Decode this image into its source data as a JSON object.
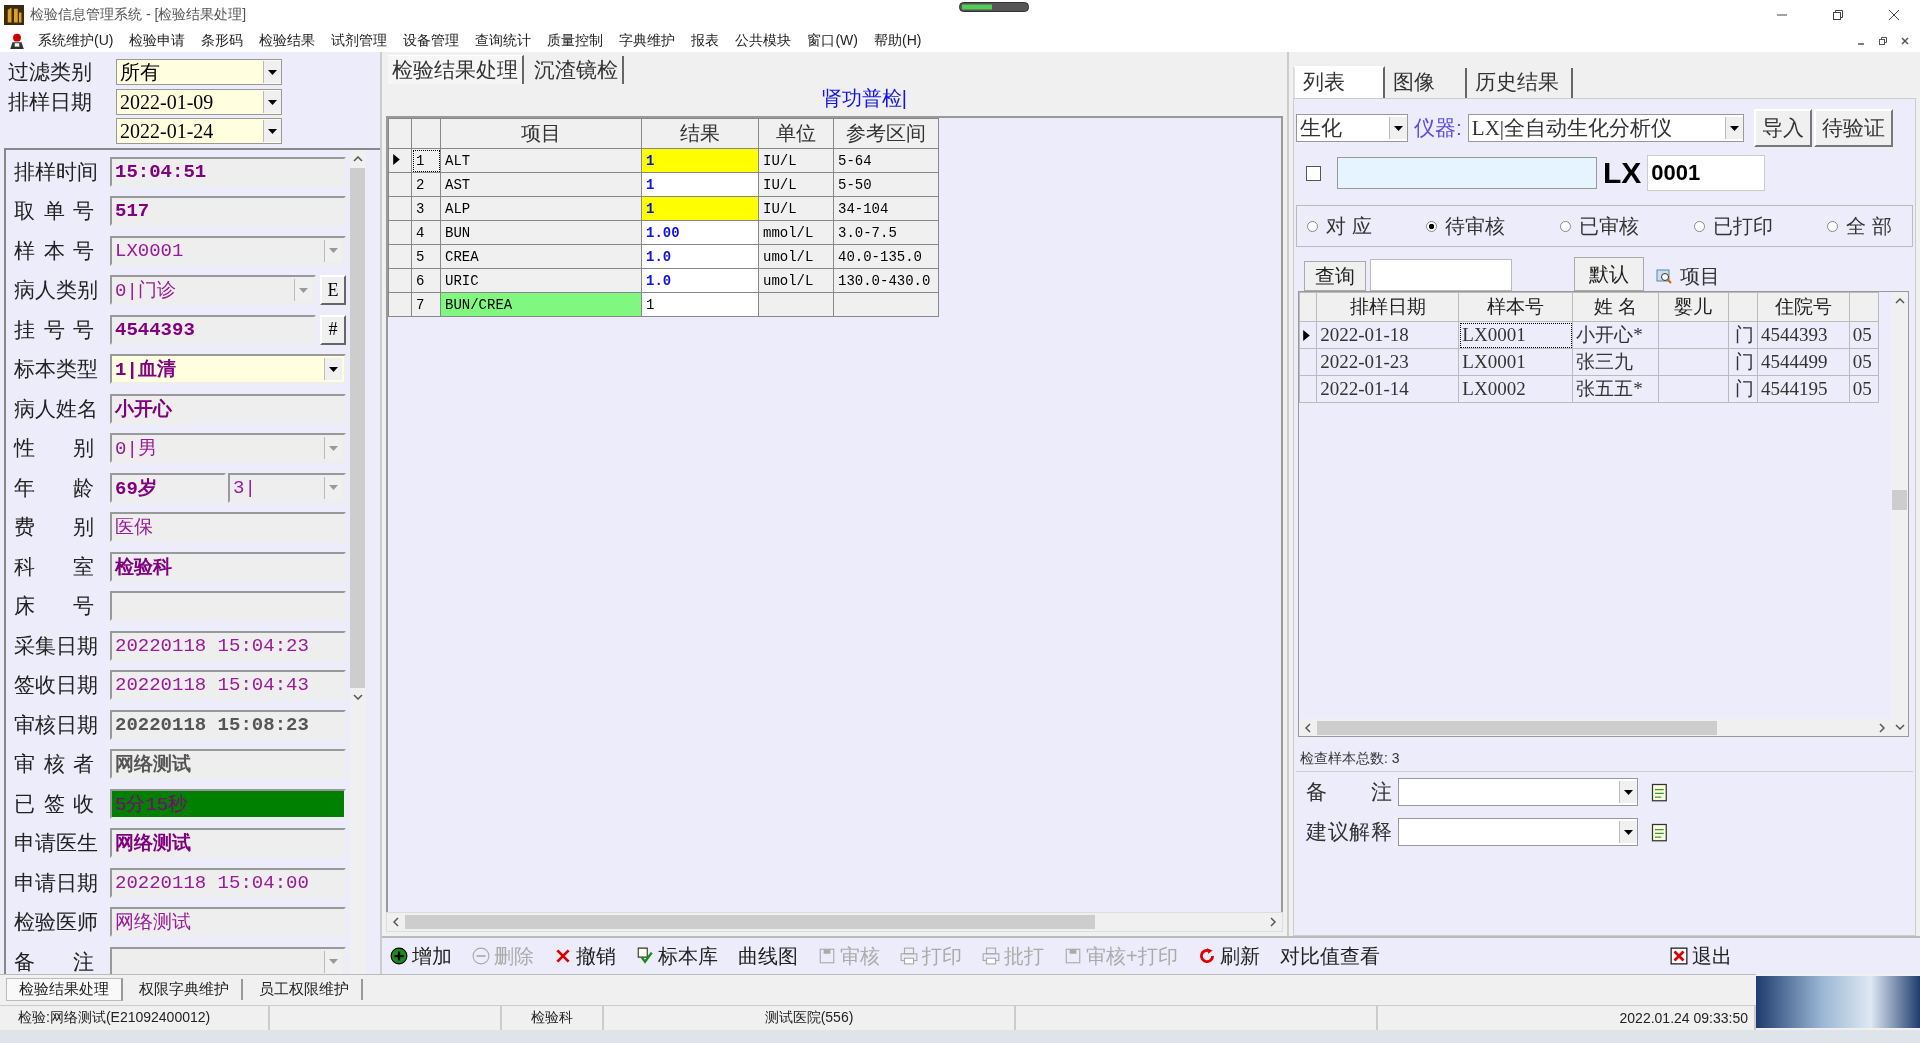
{
  "window": {
    "title": "检验信息管理系统 - [检验结果处理]"
  },
  "menu": [
    "系统维护(U)",
    "检验申请",
    "条形码",
    "检验结果",
    "试剂管理",
    "设备管理",
    "查询统计",
    "质量控制",
    "字典维护",
    "报表",
    "公共模块",
    "窗口(W)",
    "帮助(H)"
  ],
  "filter": {
    "type_label": "过滤类别",
    "type_value": "所有",
    "date_label": "排样日期",
    "date_from": "2022-01-09",
    "date_to": "2022-01-24"
  },
  "form": [
    {
      "label": "排样时间",
      "value": "15:04:51",
      "kind": "text"
    },
    {
      "label": "取 单 号",
      "value": "517",
      "kind": "text"
    },
    {
      "label": "样 本 号",
      "value": "LX0001",
      "kind": "combo"
    },
    {
      "label": "病人类别",
      "value": "0|门诊",
      "kind": "combo-button",
      "button": "E"
    },
    {
      "label": "挂 号 号",
      "value": "4544393",
      "kind": "text-button",
      "button": "#"
    },
    {
      "label": "标本类型",
      "value": "1|血清",
      "kind": "required-combo"
    },
    {
      "label": "病人姓名",
      "value": "小开心",
      "kind": "text"
    },
    {
      "label": "性 别",
      "value": "0|男",
      "kind": "combo"
    },
    {
      "label": "年 龄",
      "value": "69岁",
      "kind": "age",
      "unit": "3|"
    },
    {
      "label": "费 别",
      "value": "医保",
      "kind": "text"
    },
    {
      "label": "科 室",
      "value": "检验科",
      "kind": "text"
    },
    {
      "label": "床 号",
      "kind": "text"
    },
    {
      "label": "采集日期",
      "value": "20220118 15:04:23",
      "kind": "text"
    },
    {
      "label": "签收日期",
      "value": "20220118 15:04:43",
      "kind": "text"
    },
    {
      "label": "审核日期",
      "value": "20220118 15:08:23",
      "kind": "text"
    },
    {
      "label": "审 核 者",
      "value": "网络测试",
      "kind": "text"
    },
    {
      "label": "已 签 收",
      "value": "5分15秒",
      "kind": "status"
    },
    {
      "label": "申请医生",
      "value": "网络测试",
      "kind": "text"
    },
    {
      "label": "申请日期",
      "value": "20220118 15:04:00",
      "kind": "text"
    },
    {
      "label": "检验医师",
      "value": "网络测试",
      "kind": "text"
    },
    {
      "label": "备 注",
      "kind": "combo"
    }
  ],
  "main_tabs": [
    {
      "label": "检验结果处理",
      "selected": true
    },
    {
      "label": "沉渣镜检",
      "selected": false
    }
  ],
  "panel_title": "肾功普检|",
  "results": {
    "columns": [
      "项目",
      "结果",
      "单位",
      "参考区间"
    ],
    "rows": [
      {
        "no": "1",
        "item": "ALT",
        "result": "1",
        "unit": "IU/L",
        "range": "5-64",
        "selected": true,
        "abnormal": true,
        "kind": "measured"
      },
      {
        "no": "2",
        "item": "AST",
        "result": "1",
        "unit": "IU/L",
        "range": "5-50",
        "selected": false,
        "abnormal": false,
        "kind": "measured"
      },
      {
        "no": "3",
        "item": "ALP",
        "result": "1",
        "unit": "IU/L",
        "range": "34-104",
        "selected": false,
        "abnormal": true,
        "kind": "measured"
      },
      {
        "no": "4",
        "item": "BUN",
        "result": "1.00",
        "unit": "mmol/L",
        "range": "3.0-7.5",
        "selected": false,
        "abnormal": false,
        "kind": "measured"
      },
      {
        "no": "5",
        "item": "CREA",
        "result": "1.0",
        "unit": "umol/L",
        "range": "40.0-135.0",
        "selected": false,
        "abnormal": false,
        "kind": "measured"
      },
      {
        "no": "6",
        "item": "URIC",
        "result": "1.0",
        "unit": "umol/L",
        "range": "130.0-430.0",
        "selected": false,
        "abnormal": false,
        "kind": "measured"
      },
      {
        "no": "7",
        "item": "BUN/CREA",
        "result": "1",
        "selected": false,
        "abnormal": false,
        "kind": "calculated"
      }
    ]
  },
  "right": {
    "tabs": [
      {
        "label": "列表",
        "selected": true
      },
      {
        "label": "图像",
        "selected": false
      },
      {
        "label": "历史结果",
        "selected": false
      }
    ],
    "category": "生化",
    "instrument_label": "仪器:",
    "instrument": "LX|全自动生化分析仪",
    "buttons": [
      "导入",
      "待验证"
    ],
    "checked": false,
    "prefix": "LX",
    "sample_no": "0001",
    "radios": [
      {
        "label": "对 应",
        "selected": false
      },
      {
        "label": "待审核",
        "selected": true
      },
      {
        "label": "已审核",
        "selected": false
      },
      {
        "label": "已打印",
        "selected": false
      },
      {
        "label": "全 部",
        "selected": false
      }
    ],
    "query_button": "查询",
    "default_button": "默认",
    "items_button": "项目",
    "columns": [
      "排样日期",
      "样本号",
      "姓 名",
      "婴儿",
      "住院号"
    ],
    "rows": [
      {
        "date": "2022-01-18",
        "sample_no": "LX0001",
        "name": "小开心*",
        "column_5": "门",
        "inpatient_no": "4544393",
        "column_7": "05",
        "selected": true
      },
      {
        "date": "2022-01-23",
        "sample_no": "LX0001",
        "name": "张三九",
        "column_5": "门",
        "inpatient_no": "4544499",
        "column_7": "05",
        "selected": false
      },
      {
        "date": "2022-01-14",
        "sample_no": "LX0002",
        "name": "张五五*",
        "column_5": "门",
        "inpatient_no": "4544195",
        "column_7": "05",
        "selected": false
      }
    ],
    "total": "检查样本总数: 3",
    "remark_label": "备 注",
    "advice_label": "建议解释"
  },
  "toolbar": [
    {
      "label": "增加",
      "disabled": false
    },
    {
      "label": "删除",
      "disabled": true
    },
    {
      "label": "撤销",
      "disabled": false
    },
    {
      "label": "标本库",
      "disabled": false
    },
    {
      "label": "曲线图",
      "disabled": false
    },
    {
      "label": "审核",
      "disabled": true
    },
    {
      "label": "打印",
      "disabled": true
    },
    {
      "label": "批打",
      "disabled": true
    },
    {
      "label": "审核+打印",
      "disabled": true
    },
    {
      "label": "刷新",
      "disabled": false
    },
    {
      "label": "对比值查看",
      "disabled": false
    },
    {
      "label": "退出",
      "disabled": false
    }
  ],
  "bottom_tabs": [
    {
      "label": "检验结果处理",
      "selected": true
    },
    {
      "label": "权限字典维护",
      "selected": false
    },
    {
      "label": "员工权限维护",
      "selected": false
    }
  ],
  "status_bar": {
    "user": "检验:网络测试(E21092400012)",
    "department": "检验科",
    "hospital": "测试医院(556)",
    "datetime": "2022.01.24 09:33:50"
  }
}
